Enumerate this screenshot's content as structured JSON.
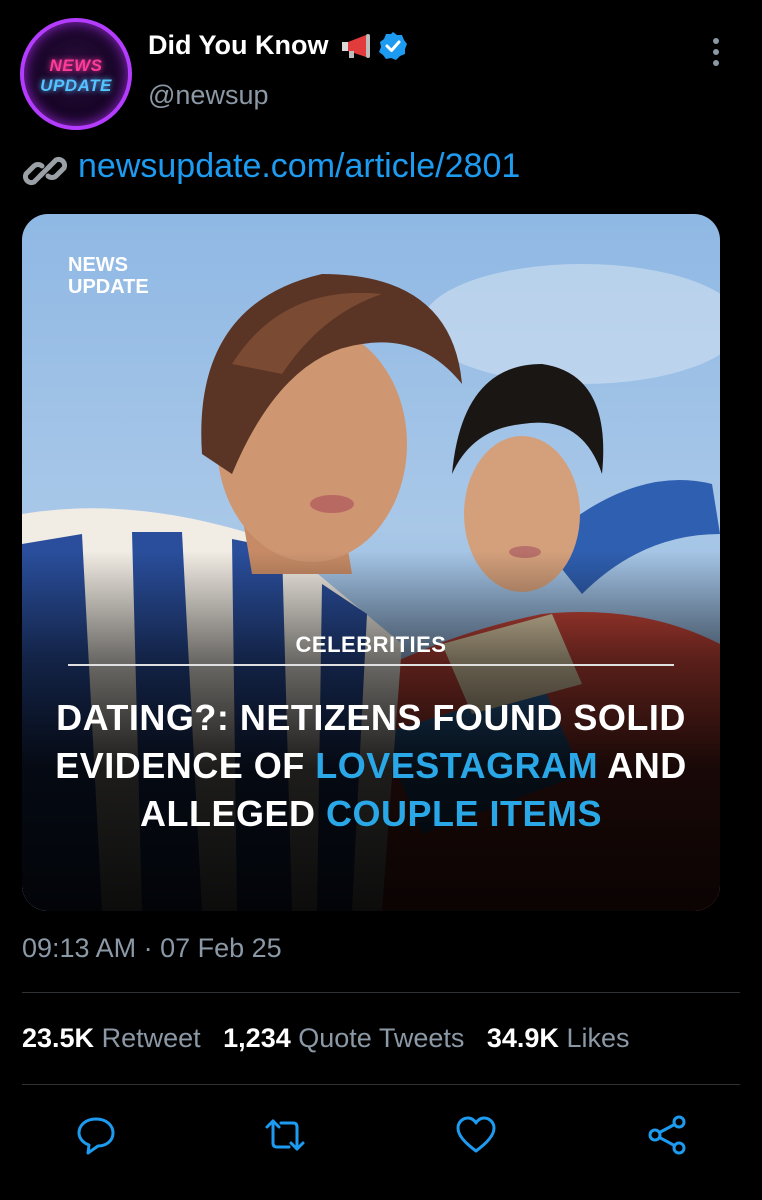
{
  "author": {
    "display_name": "Did You Know",
    "handle": "@newsup",
    "avatar_line1": "NEWS",
    "avatar_line2": "UPDATE",
    "badge_icon": "megaphone-icon",
    "verified_icon": "verified-badge-icon"
  },
  "tweet": {
    "link_icon": "link-icon",
    "link_text": "newsupdate.com/article/2801",
    "timestamp": "09:13 AM · 07 Feb 25"
  },
  "card": {
    "watermark_line1": "NEWS",
    "watermark_line2": "UPDATE",
    "category": "CELEBRITIES",
    "headline": {
      "part1": "DATING?: NETIZENS FOUND SOLID EVIDENCE OF",
      "highlight1": "LOVESTAGRAM",
      "part2": "AND ALLEGED",
      "highlight2": "COUPLE ITEMS"
    }
  },
  "stats": {
    "retweets_count": "23.5K",
    "retweets_label": "Retweet",
    "quotes_count": "1,234",
    "quotes_label": "Quote Tweets",
    "likes_count": "34.9K",
    "likes_label": "Likes"
  },
  "actions": [
    "reply-icon",
    "retweet-icon",
    "like-icon",
    "share-icon"
  ],
  "colors": {
    "background": "#000000",
    "link": "#1d9bf0",
    "secondary_text": "#8b98a5",
    "headline_highlight": "#2aa7e6",
    "avatar_ring": "#b43cff"
  }
}
